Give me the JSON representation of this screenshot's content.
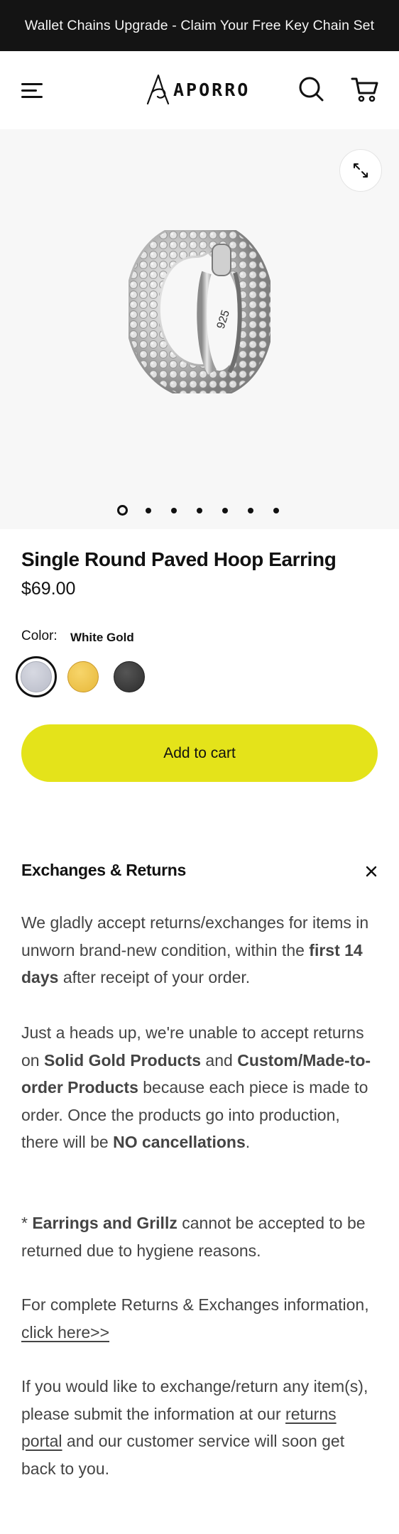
{
  "announcement": {
    "text": "Wallet Chains Upgrade - Claim Your Free Key Chain Set"
  },
  "header": {
    "logo_text": "APORRO",
    "menu_icon": "hamburger-menu-icon",
    "search_icon": "search-icon",
    "cart_icon": "cart-icon"
  },
  "gallery": {
    "expand_icon": "expand-icon",
    "image_stamp": "925",
    "slide_count": 7,
    "active_slide": 1
  },
  "product": {
    "title": "Single Round Paved Hoop Earring",
    "price": "$69.00",
    "color_label": "Color:",
    "color_value": "White Gold",
    "swatches": [
      {
        "name": "White Gold",
        "color": "#c8cad4",
        "selected": true
      },
      {
        "name": "Gold",
        "color": "#f0c64f",
        "selected": false
      },
      {
        "name": "Black",
        "color": "#3a3a3a",
        "selected": false
      }
    ],
    "add_to_cart": "Add to cart",
    "button_color": "#e4e31a"
  },
  "returns": {
    "title": "Exchanges & Returns",
    "p1": {
      "a": "We gladly accept returns/exchanges for items in unworn brand-new condition, within the ",
      "b": "first 14 days",
      "c": " after receipt of your order."
    },
    "p2": {
      "a": "Just a heads up, we're unable to accept returns on ",
      "b": "Solid Gold Products",
      "c": " and ",
      "d": "Custom/Made-to-order Products",
      "e": " because each piece is made to order. Once the products go into production, there will be ",
      "f": "NO cancellations",
      "g": "."
    },
    "p3": {
      "a": "* ",
      "b": "Earrings and Grillz",
      "c": " cannot be accepted to be returned due to hygiene reasons."
    },
    "p4": {
      "a": "For complete Returns & Exchanges information, ",
      "link": "click here>>"
    },
    "p5": {
      "a": "If you would like to exchange/return any item(s), please submit the information at our ",
      "link": "returns portal",
      "b": " and our customer service will soon get back to you."
    }
  }
}
